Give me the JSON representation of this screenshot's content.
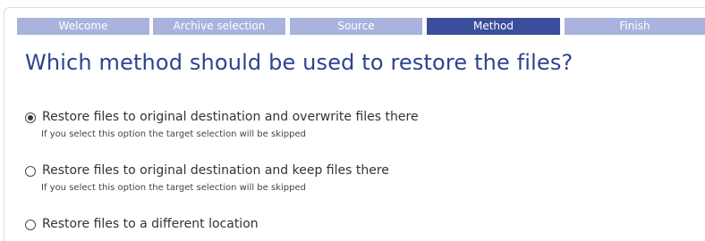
{
  "wizard": {
    "steps": [
      {
        "label": "Welcome"
      },
      {
        "label": "Archive selection"
      },
      {
        "label": "Source"
      },
      {
        "label": "Method"
      },
      {
        "label": "Finish"
      }
    ],
    "active_step": "Method",
    "colors": {
      "step_inactive": "#a9b3de",
      "step_active": "#3b4e9c",
      "title": "#2d438f"
    }
  },
  "page": {
    "title": "Which method should be used to restore the files?"
  },
  "options": [
    {
      "label": "Restore files to original destination and overwrite files there",
      "hint": "If you select this option the target selection will be skipped",
      "selected": true
    },
    {
      "label": "Restore files to original destination and keep files there",
      "hint": "If you select this option the target selection will be skipped",
      "selected": false
    },
    {
      "label": "Restore files to a different location",
      "selected": false
    }
  ]
}
